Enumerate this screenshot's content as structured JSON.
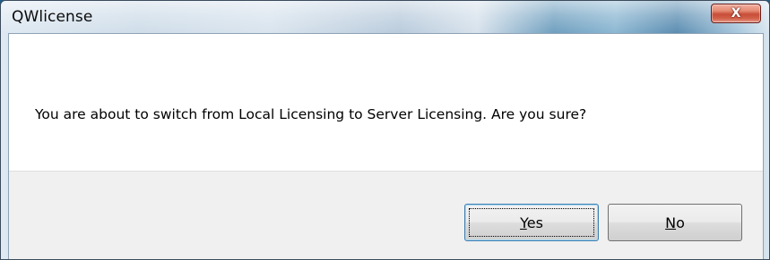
{
  "window": {
    "title": "QWlicense",
    "close_glyph": "X"
  },
  "message": {
    "text": "You are about to switch from Local Licensing to Server Licensing. Are you sure?"
  },
  "buttons": {
    "yes": {
      "accel": "Y",
      "rest": "es",
      "is_default": true
    },
    "no": {
      "accel": "N",
      "rest": "o",
      "is_default": false
    }
  },
  "icons": {
    "close": "close-icon"
  },
  "colors": {
    "close_button": "#c84d37",
    "button_face": "#e6e6e6",
    "button_strip": "#f0f0f0",
    "default_button_border": "#3c7fb1"
  }
}
